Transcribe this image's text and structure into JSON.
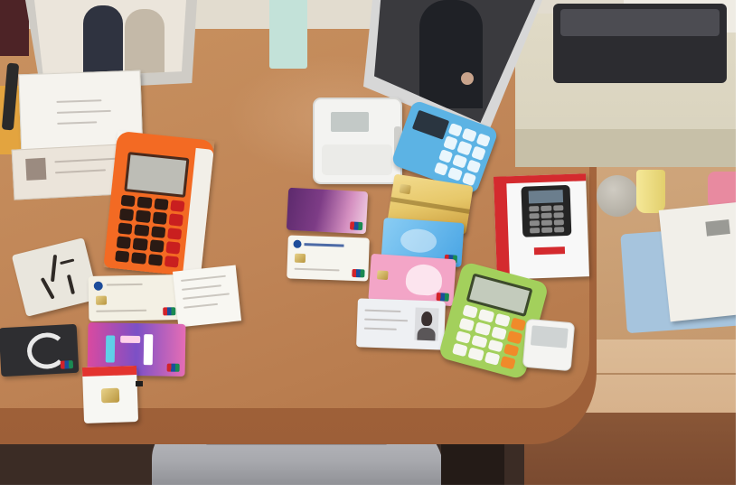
{
  "colors": {
    "wall": "#e2dccf",
    "desk_top": "#bf8456",
    "desk_edge": "#9d5f38",
    "side_surface": "#c69a6f",
    "cabinet_front": "#d7b28c",
    "floor": "#7a4a30",
    "under_desk": "#3b2c25",
    "chair_fabric": "#a7a8ad",
    "orange_terminal": "#f36a23",
    "blue_terminal": "#5cb3e4",
    "green_terminal": "#a3d05c",
    "red_box": "#d42a2e",
    "purple_card": "#7d3c86",
    "gold_card": "#e7c86a",
    "blue_card": "#49a5e4",
    "pink_card": "#f3a5c7",
    "photo_dark": "#3a3a3e",
    "beige_box": "#d8d2bd",
    "blue_cloth": "#a6c4dd"
  }
}
